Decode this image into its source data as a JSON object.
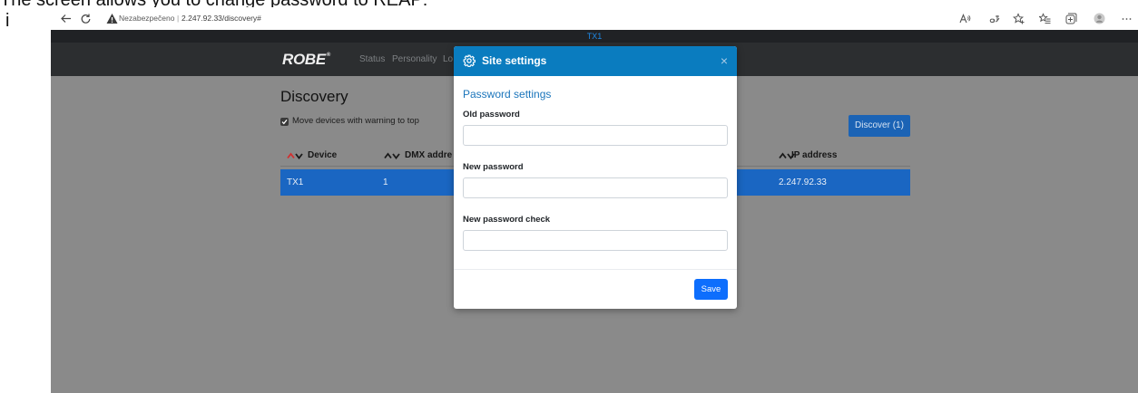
{
  "caption": {
    "text": "The screen allows you to change password to REAP:",
    "marker": "i"
  },
  "browser": {
    "icons": {
      "back": "back-arrow-icon",
      "refresh": "refresh-icon",
      "warning": "warning-icon",
      "read_aloud": "read-aloud-icon",
      "translate": "translate-icon",
      "add_favorite": "add-favorite-icon",
      "favorites": "favorites-icon",
      "collections": "collections-icon",
      "profile": "profile-avatar-icon",
      "more": "more-icon"
    },
    "security_label": "Nezabezpečeno",
    "separator": "|",
    "url": "2.247.92.33/discovery#"
  },
  "app": {
    "device_name": "TX1",
    "logo": "ROBE",
    "logo_mark": "®",
    "nav": [
      "Status",
      "Personality",
      "Lo"
    ]
  },
  "discovery": {
    "title": "Discovery",
    "move_warning_checkbox": {
      "label": "Move devices with warning to top",
      "checked": true
    },
    "discover_button": "Discover (1)",
    "columns": [
      {
        "label": "Device",
        "sorted_ascending": true
      },
      {
        "label": "DMX addre",
        "sorted_ascending": false
      },
      {
        "label": "IP address",
        "sorted_ascending": false
      }
    ],
    "rows": [
      {
        "device": "TX1",
        "dmx": "1",
        "ip": "2.247.92.33",
        "selected": true
      }
    ]
  },
  "modal": {
    "title": "Site settings",
    "close": "×",
    "section": "Password settings",
    "fields": [
      {
        "label": "Old password",
        "value": "",
        "placeholder": ""
      },
      {
        "label": "New password",
        "value": "",
        "placeholder": ""
      },
      {
        "label": "New password check",
        "value": "",
        "placeholder": ""
      }
    ],
    "save_label": "Save"
  },
  "theme": {
    "modal_header": "#0a7cbf",
    "accent": "#0d6efd",
    "row_selected": "#1a66c2",
    "sorted": "#d22f2f",
    "device_name": "#1e88e5",
    "navbar": "#2c2e30",
    "strip": "#202225",
    "content": "#8a8a8a",
    "link": "#1b75bb",
    "discover_button": "#1b63b5"
  }
}
